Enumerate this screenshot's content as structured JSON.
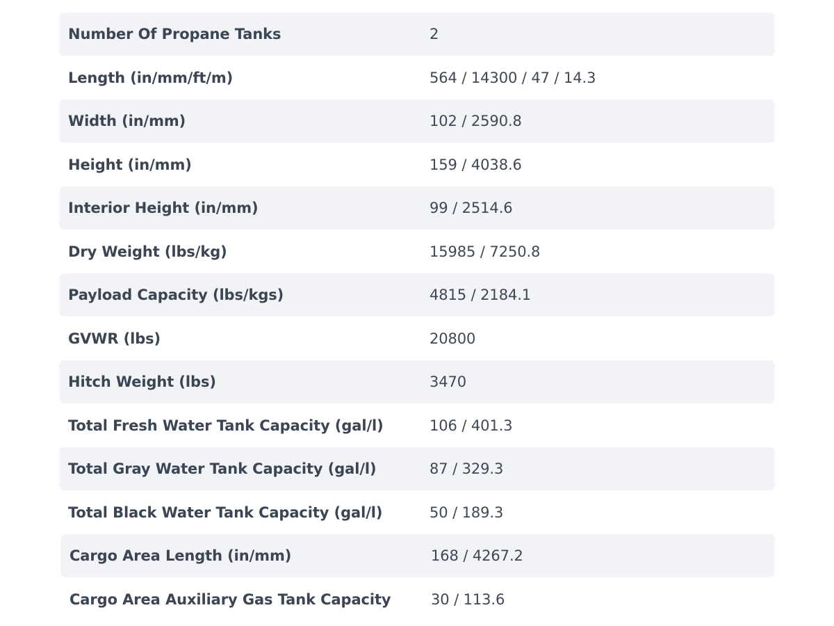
{
  "specs": {
    "rows": [
      {
        "label": "Number Of Propane Tanks",
        "value": "2"
      },
      {
        "label": "Length (in/mm/ft/m)",
        "value": "564 / 14300 / 47 / 14.3"
      },
      {
        "label": "Width (in/mm)",
        "value": "102 / 2590.8"
      },
      {
        "label": "Height (in/mm)",
        "value": "159 / 4038.6"
      },
      {
        "label": "Interior Height (in/mm)",
        "value": "99 / 2514.6"
      },
      {
        "label": "Dry Weight (lbs/kg)",
        "value": "15985 / 7250.8"
      },
      {
        "label": "Payload Capacity (lbs/kgs)",
        "value": "4815 / 2184.1"
      },
      {
        "label": "GVWR (lbs)",
        "value": "20800"
      },
      {
        "label": "Hitch Weight (lbs)",
        "value": "3470"
      },
      {
        "label": "Total Fresh Water Tank Capacity (gal/l)",
        "value": "106 / 401.3"
      },
      {
        "label": "Total Gray Water Tank Capacity (gal/l)",
        "value": "87 / 329.3"
      },
      {
        "label": "Total Black Water Tank Capacity (gal/l)",
        "value": "50 / 189.3"
      },
      {
        "label": "Cargo Area Length (in/mm)",
        "value": "168 / 4267.2"
      },
      {
        "label": "Cargo Area Auxiliary Gas Tank Capacity",
        "value": "30 / 113.6"
      }
    ]
  },
  "colors": {
    "row_shade": "#f1f3f6",
    "text": "#3b4553"
  }
}
